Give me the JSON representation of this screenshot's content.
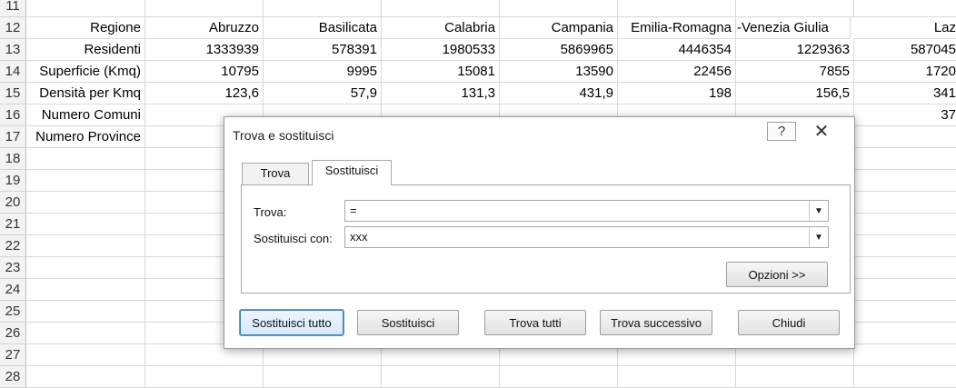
{
  "sheet": {
    "rows": [
      {
        "num": "11",
        "cells": [
          "",
          "",
          "",
          "",
          "",
          "",
          "",
          ""
        ]
      },
      {
        "num": "12",
        "cells": [
          "Regione",
          "Abruzzo",
          "Basilicata",
          "Calabria",
          "Campania",
          "Emilia-Romagna",
          "uli-Venezia Giulia",
          "Laz"
        ]
      },
      {
        "num": "13",
        "cells": [
          "Residenti",
          "1333939",
          "578391",
          "1980533",
          "5869965",
          "4446354",
          "1229363",
          "587045"
        ]
      },
      {
        "num": "14",
        "cells": [
          "Superficie (Kmq)",
          "10795",
          "9995",
          "15081",
          "13590",
          "22456",
          "7855",
          "1720"
        ]
      },
      {
        "num": "15",
        "cells": [
          "Densità per Kmq",
          "123,6",
          "57,9",
          "131,3",
          "431,9",
          "198",
          "156,5",
          "341"
        ]
      },
      {
        "num": "16",
        "cells": [
          "Numero Comuni",
          "",
          "",
          "",
          "",
          "",
          "",
          "37"
        ]
      },
      {
        "num": "17",
        "cells": [
          "Numero Province",
          "",
          "",
          "",
          "",
          "",
          "",
          ""
        ]
      },
      {
        "num": "18",
        "cells": [
          "",
          "",
          "",
          "",
          "",
          "",
          "",
          ""
        ]
      },
      {
        "num": "19",
        "cells": [
          "",
          "",
          "",
          "",
          "",
          "",
          "",
          ""
        ]
      },
      {
        "num": "20",
        "cells": [
          "",
          "",
          "",
          "",
          "",
          "",
          "",
          ""
        ]
      },
      {
        "num": "21",
        "cells": [
          "",
          "",
          "",
          "",
          "",
          "",
          "",
          ""
        ]
      },
      {
        "num": "22",
        "cells": [
          "",
          "",
          "",
          "",
          "",
          "",
          "",
          ""
        ]
      },
      {
        "num": "23",
        "cells": [
          "",
          "",
          "",
          "",
          "",
          "",
          "",
          ""
        ]
      },
      {
        "num": "24",
        "cells": [
          "",
          "",
          "",
          "",
          "",
          "",
          "",
          ""
        ]
      },
      {
        "num": "25",
        "cells": [
          "",
          "",
          "",
          "",
          "",
          "",
          "",
          ""
        ]
      },
      {
        "num": "26",
        "cells": [
          "",
          "",
          "",
          "",
          "",
          "",
          "",
          ""
        ]
      },
      {
        "num": "27",
        "cells": [
          "",
          "",
          "",
          "",
          "",
          "",
          "",
          ""
        ]
      },
      {
        "num": "28",
        "cells": [
          "",
          "",
          "",
          "",
          "",
          "",
          "",
          ""
        ]
      }
    ]
  },
  "dialog": {
    "title": "Trova e sostituisci",
    "help_glyph": "?",
    "close_glyph": "✕",
    "tabs": {
      "find": "Trova",
      "replace": "Sostituisci"
    },
    "find_label": "Trova:",
    "find_value": "=",
    "replace_label": "Sostituisci con:",
    "replace_value": "xxx",
    "options_button": "Opzioni >>",
    "buttons": {
      "replace_all": "Sostituisci tutto",
      "replace": "Sostituisci",
      "find_all": "Trova tutti",
      "find_next": "Trova successivo",
      "close": "Chiudi"
    },
    "accent_color": "#f5f500"
  }
}
